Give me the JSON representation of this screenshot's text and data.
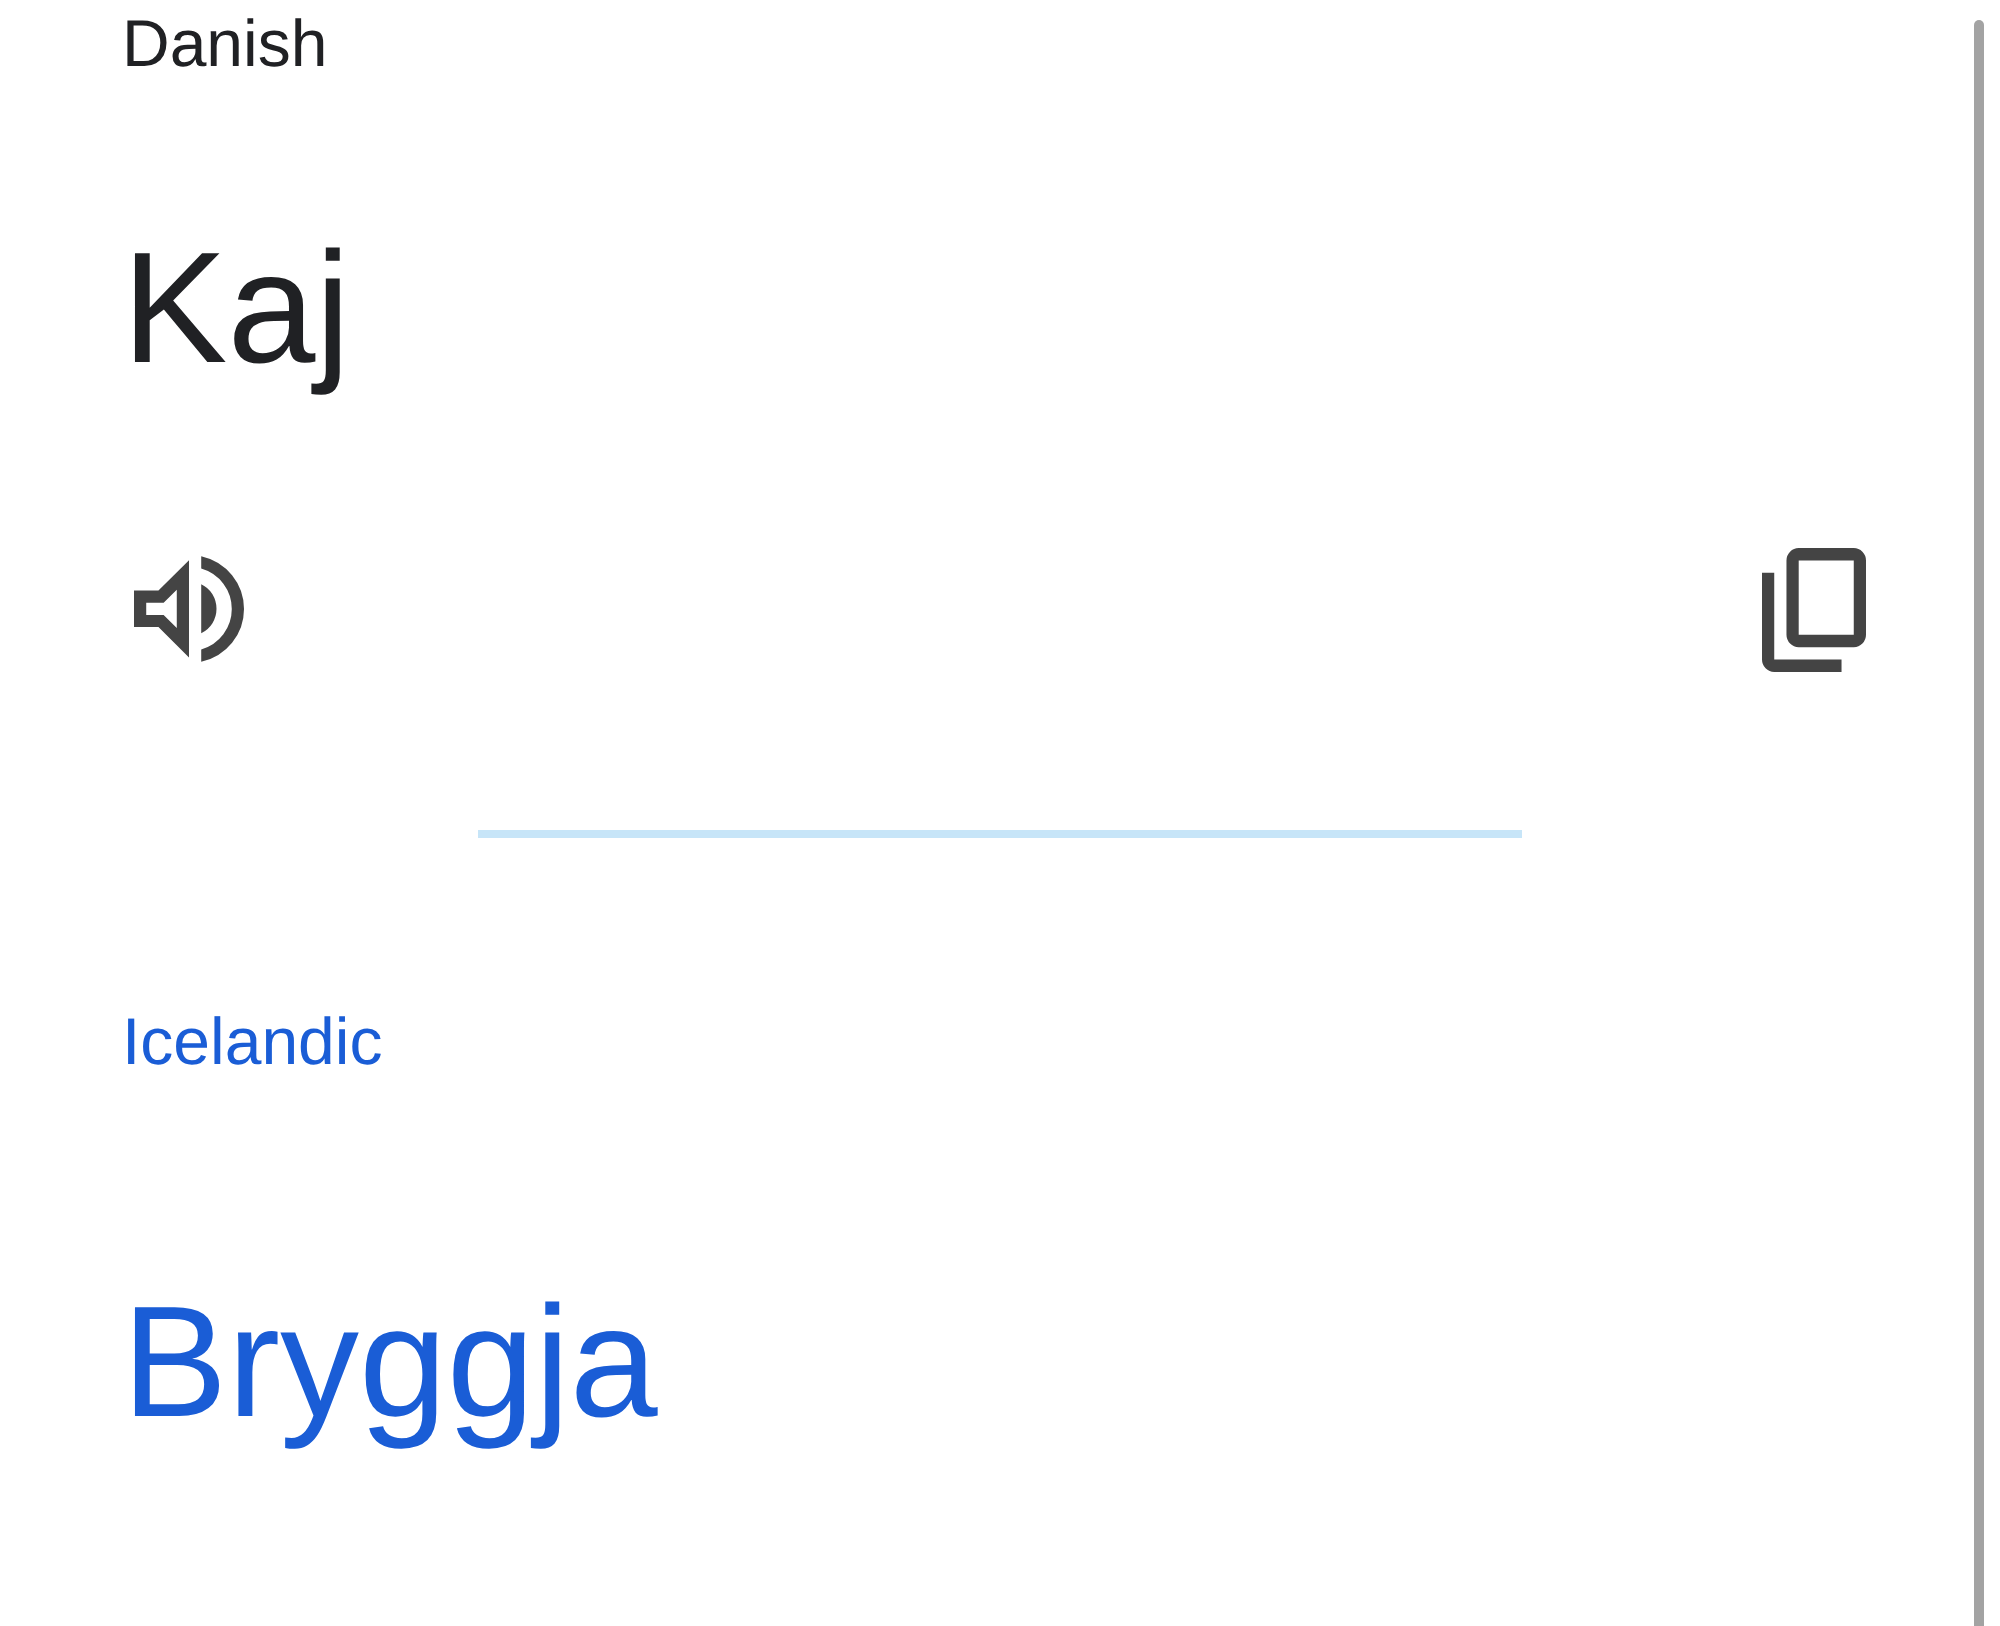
{
  "source": {
    "language": "Danish",
    "text": "Kaj"
  },
  "translation": {
    "language": "Icelandic",
    "text": "Bryggja"
  }
}
